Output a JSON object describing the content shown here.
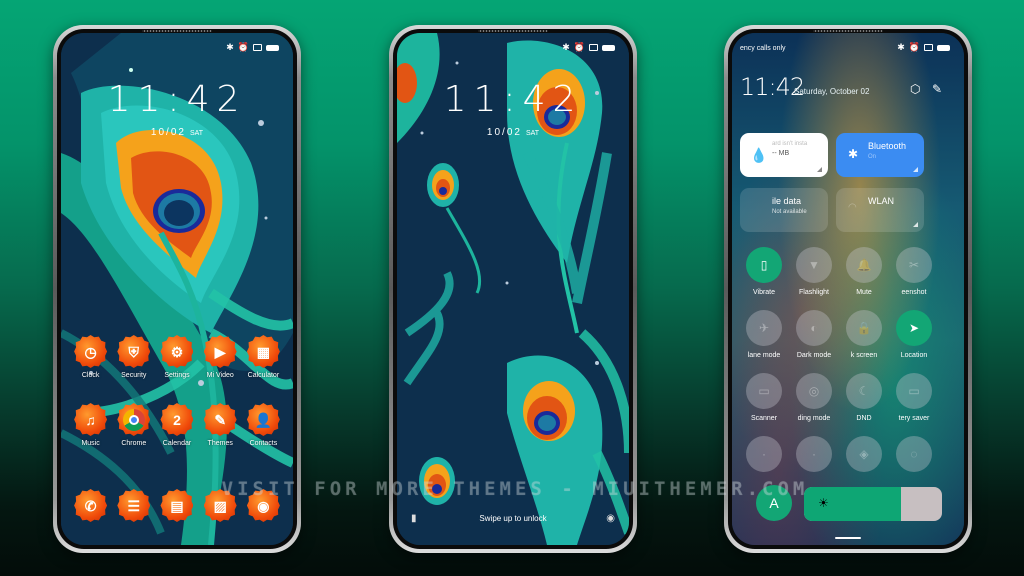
{
  "colors": {
    "background_top": "#05a574",
    "background_bottom": "#030c09",
    "wallpaper_navy": "#0d2f4d",
    "icon_orange": "#f04a0a",
    "accent_green": "#13a675",
    "bluetooth_blue": "#3b8cf2"
  },
  "status_bar": {
    "icons": [
      "bluetooth-icon",
      "alarm-icon",
      "sim-icon",
      "battery-icon"
    ]
  },
  "home_screen": {
    "time": "11:42",
    "date": "10/02",
    "day": "SAT",
    "apps_row1": [
      {
        "label": "Clock",
        "icon": "clock-icon",
        "glyph": "◷"
      },
      {
        "label": "Security",
        "icon": "shield-icon",
        "glyph": "⛨"
      },
      {
        "label": "Settings",
        "icon": "gear-icon",
        "glyph": "⚙"
      },
      {
        "label": "Mi Video",
        "icon": "play-icon",
        "glyph": "▶"
      },
      {
        "label": "Calculator",
        "icon": "calculator-icon",
        "glyph": "▦"
      }
    ],
    "apps_row2": [
      {
        "label": "Music",
        "icon": "music-note-icon",
        "glyph": "♫"
      },
      {
        "label": "Chrome",
        "icon": "chrome-icon",
        "glyph": ""
      },
      {
        "label": "Calendar",
        "icon": "calendar-icon",
        "glyph": "2"
      },
      {
        "label": "Themes",
        "icon": "paintbrush-icon",
        "glyph": "✎"
      },
      {
        "label": "Contacts",
        "icon": "person-icon",
        "glyph": "👤"
      }
    ],
    "dock": [
      {
        "icon": "phone-icon",
        "glyph": "✆"
      },
      {
        "icon": "message-icon",
        "glyph": "☰"
      },
      {
        "icon": "notes-icon",
        "glyph": "▤"
      },
      {
        "icon": "gallery-icon",
        "glyph": "▨"
      },
      {
        "icon": "camera-icon",
        "glyph": "◉"
      }
    ]
  },
  "lock_screen": {
    "time": "11:42",
    "date": "10/02",
    "day": "SAT",
    "swipe_hint": "Swipe up to unlock",
    "flashlight_glyph": "▮",
    "camera_glyph": "◉"
  },
  "control_center": {
    "carrier_text": "ency calls only",
    "time": "11:42",
    "date": "Saturday, October 02",
    "settings_glyph": "⬡",
    "edit_glyph": "✎",
    "tiles": [
      {
        "title": "ard isn't insta",
        "subtitle": "-- MB",
        "icon": "water-drop-icon"
      },
      {
        "title": "Bluetooth",
        "subtitle": "On",
        "icon": "bluetooth-icon"
      },
      {
        "title": "ile data",
        "subtitle": "Not available",
        "icon": "mobile-data-icon"
      },
      {
        "title": "WLAN",
        "subtitle": "",
        "icon": "wifi-icon"
      }
    ],
    "toggles": [
      {
        "label": "Vibrate",
        "icon": "vibrate-icon",
        "glyph": "▯",
        "on": true
      },
      {
        "label": "Flashlight",
        "icon": "flashlight-icon",
        "glyph": "▼",
        "on": false
      },
      {
        "label": "Mute",
        "icon": "bell-icon",
        "glyph": "🔔",
        "on": false
      },
      {
        "label": "eenshot",
        "icon": "screenshot-icon",
        "glyph": "✂",
        "on": false
      },
      {
        "label": "lane mode",
        "icon": "airplane-icon",
        "glyph": "✈",
        "on": false
      },
      {
        "label": "Dark mode",
        "icon": "dark-mode-icon",
        "glyph": "◐",
        "on": false
      },
      {
        "label": "k screen",
        "icon": "lock-icon",
        "glyph": "🔒",
        "on": false
      },
      {
        "label": "Location",
        "icon": "location-arrow-icon",
        "glyph": "➤",
        "on": true
      },
      {
        "label": "Scanner",
        "icon": "scanner-icon",
        "glyph": "▭",
        "on": false
      },
      {
        "label": "ding mode",
        "icon": "reading-mode-icon",
        "glyph": "◎",
        "on": false
      },
      {
        "label": "DND",
        "icon": "moon-icon",
        "glyph": "☾",
        "on": false
      },
      {
        "label": "tery saver",
        "icon": "battery-saver-icon",
        "glyph": "▭",
        "on": false
      },
      {
        "label": "",
        "icon": "toggle-icon",
        "glyph": "·",
        "on": false
      },
      {
        "label": "",
        "icon": "toggle-icon",
        "glyph": "·",
        "on": false
      },
      {
        "label": "",
        "icon": "cast-icon",
        "glyph": "◈",
        "on": false
      },
      {
        "label": "",
        "icon": "toggle-icon",
        "glyph": "◌",
        "on": false
      }
    ],
    "auto_brightness_label": "A",
    "brightness_percent": 70,
    "brightness_glyph": "☀"
  },
  "watermark": "VISIT FOR MORE THEMES - MIUITHEMER.COM"
}
